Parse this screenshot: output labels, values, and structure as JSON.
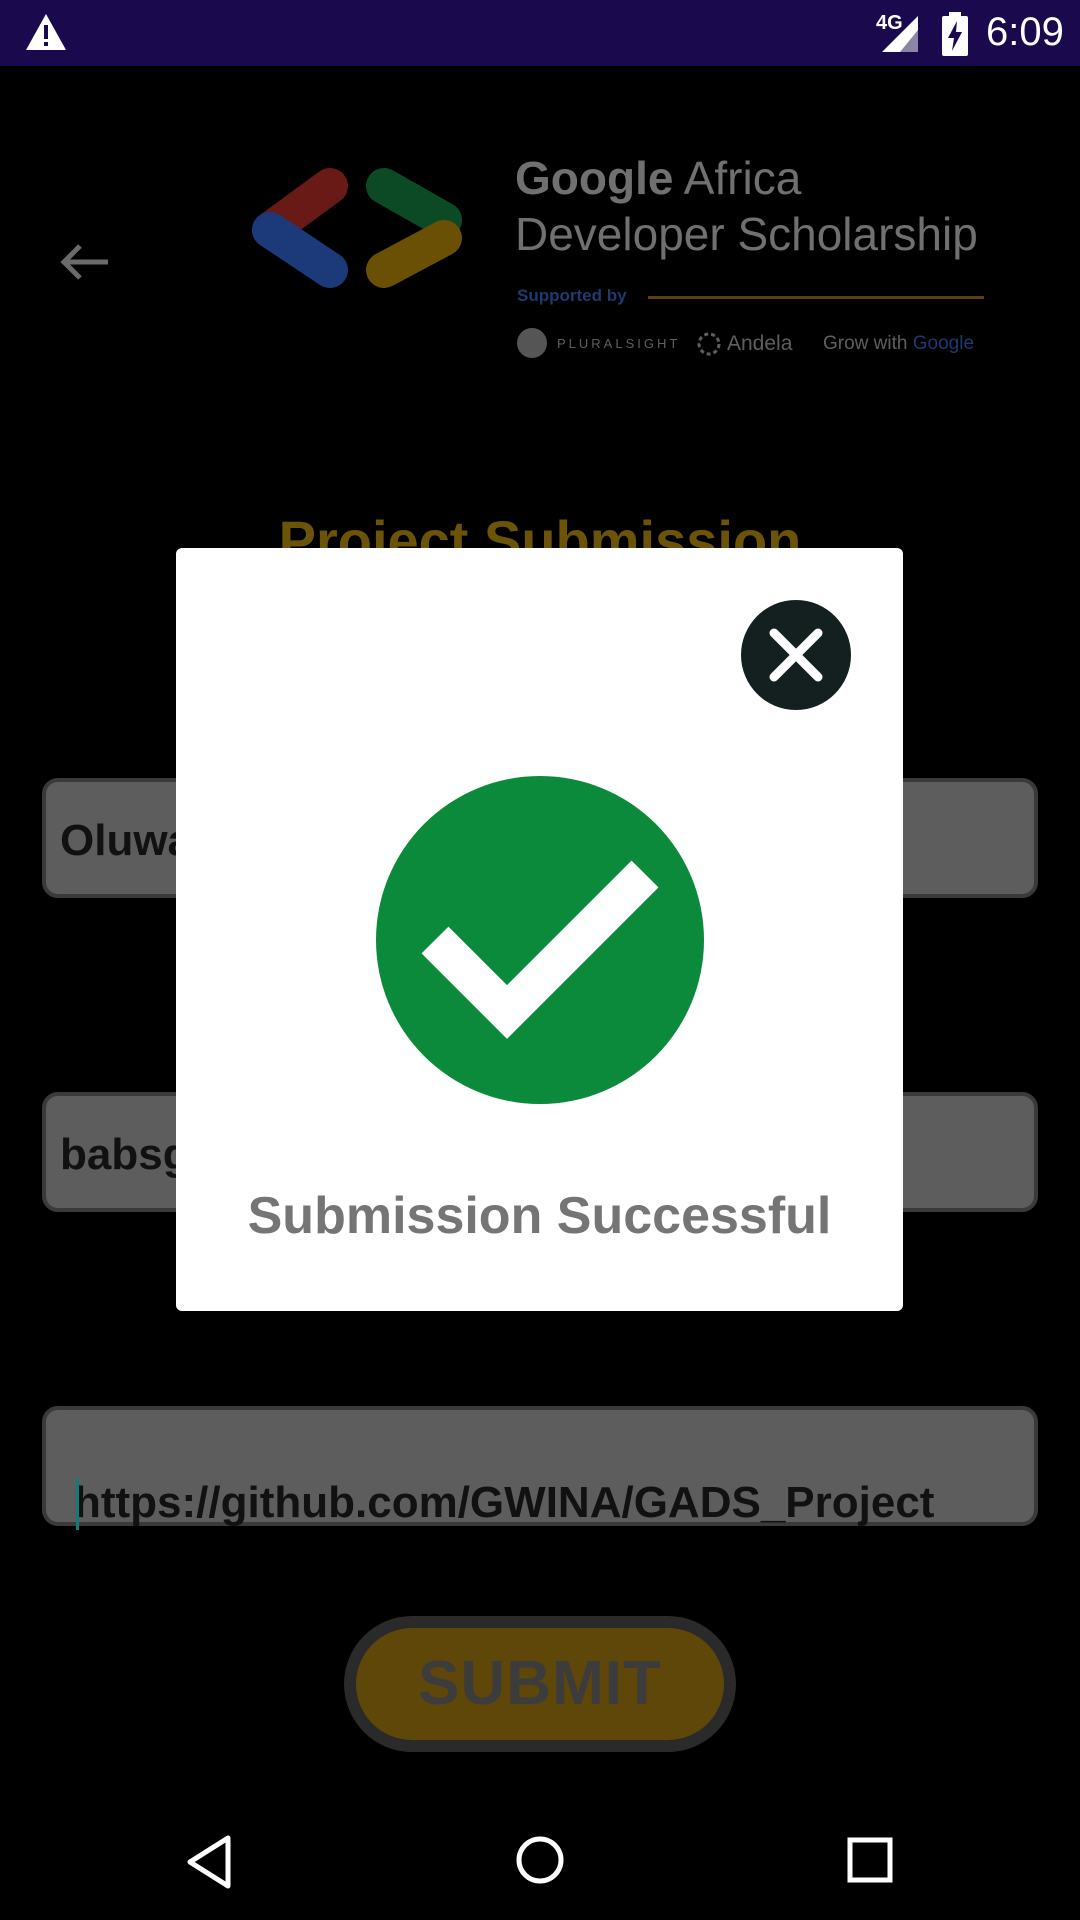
{
  "status_bar": {
    "network_label": "4G",
    "time": "6:09"
  },
  "header": {
    "brand_bold": "Google",
    "brand_rest": " Africa",
    "brand_line2": "Developer Scholarship",
    "supported_by": "Supported by",
    "partners": [
      "PLURALSIGHT",
      "Andela",
      "Grow with ",
      "Google"
    ]
  },
  "page": {
    "title": "Project Submission"
  },
  "form": {
    "first_name": "Oluwa",
    "email": "babsg",
    "project_link": "https://github.com/GWINA/GADS_Project",
    "submit_label": "SUBMIT"
  },
  "dialog": {
    "message": "Submission Successful"
  }
}
